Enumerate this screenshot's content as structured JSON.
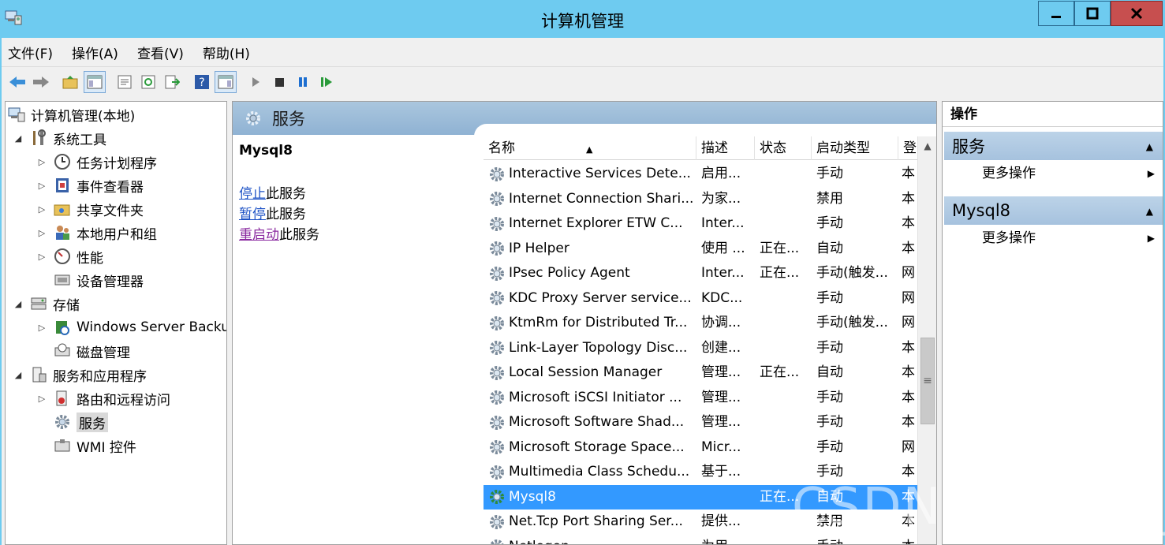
{
  "window": {
    "title": "计算机管理"
  },
  "menu": [
    "文件(F)",
    "操作(A)",
    "查看(V)",
    "帮助(H)"
  ],
  "tree": [
    {
      "label": "计算机管理(本地)",
      "level": 0,
      "arrow": "",
      "icon": "computer-management-icon"
    },
    {
      "label": "系统工具",
      "level": 1,
      "arrow": "◢",
      "icon": "system-tools-icon"
    },
    {
      "label": "任务计划程序",
      "level": 2,
      "arrow": "▷",
      "icon": "clock-icon"
    },
    {
      "label": "事件查看器",
      "level": 2,
      "arrow": "▷",
      "icon": "event-viewer-icon"
    },
    {
      "label": "共享文件夹",
      "level": 2,
      "arrow": "▷",
      "icon": "shared-folder-icon"
    },
    {
      "label": "本地用户和组",
      "level": 2,
      "arrow": "▷",
      "icon": "users-icon"
    },
    {
      "label": "性能",
      "level": 2,
      "arrow": "▷",
      "icon": "performance-icon"
    },
    {
      "label": "设备管理器",
      "level": 2,
      "arrow": "",
      "icon": "device-manager-icon"
    },
    {
      "label": "存储",
      "level": 1,
      "arrow": "◢",
      "icon": "storage-icon"
    },
    {
      "label": "Windows Server Backup",
      "level": 2,
      "arrow": "▷",
      "icon": "backup-icon"
    },
    {
      "label": "磁盘管理",
      "level": 2,
      "arrow": "",
      "icon": "disk-icon"
    },
    {
      "label": "服务和应用程序",
      "level": 1,
      "arrow": "◢",
      "icon": "services-apps-icon"
    },
    {
      "label": "路由和远程访问",
      "level": 2,
      "arrow": "▷",
      "icon": "routing-icon"
    },
    {
      "label": "服务",
      "level": 2,
      "arrow": "",
      "icon": "gear-icon",
      "selected": true
    },
    {
      "label": "WMI 控件",
      "level": 2,
      "arrow": "",
      "icon": "wmi-icon"
    }
  ],
  "center": {
    "title": "服务",
    "selected_service": "Mysql8",
    "links": [
      {
        "link": "停止",
        "rest": "此服务"
      },
      {
        "link": "暂停",
        "rest": "此服务"
      },
      {
        "link": "重启动",
        "rest": "此服务",
        "visited": true
      }
    ]
  },
  "table": {
    "columns": [
      "名称",
      "描述",
      "状态",
      "启动类型",
      "登"
    ],
    "rows": [
      {
        "name": "Interactive Services Dete...",
        "desc": "启用...",
        "status": "",
        "start": "手动",
        "logon": "本"
      },
      {
        "name": "Internet Connection Shari...",
        "desc": "为家...",
        "status": "",
        "start": "禁用",
        "logon": "本"
      },
      {
        "name": "Internet Explorer ETW C...",
        "desc": "Inter...",
        "status": "",
        "start": "手动",
        "logon": "本"
      },
      {
        "name": "IP Helper",
        "desc": "使用 ...",
        "status": "正在...",
        "start": "自动",
        "logon": "本"
      },
      {
        "name": "IPsec Policy Agent",
        "desc": "Inter...",
        "status": "正在...",
        "start": "手动(触发...",
        "logon": "网"
      },
      {
        "name": "KDC Proxy Server service...",
        "desc": "KDC...",
        "status": "",
        "start": "手动",
        "logon": "网"
      },
      {
        "name": "KtmRm for Distributed Tr...",
        "desc": "协调...",
        "status": "",
        "start": "手动(触发...",
        "logon": "网"
      },
      {
        "name": "Link-Layer Topology Disc...",
        "desc": "创建...",
        "status": "",
        "start": "手动",
        "logon": "本"
      },
      {
        "name": "Local Session Manager",
        "desc": "管理...",
        "status": "正在...",
        "start": "自动",
        "logon": "本"
      },
      {
        "name": "Microsoft iSCSI Initiator ...",
        "desc": "管理...",
        "status": "",
        "start": "手动",
        "logon": "本"
      },
      {
        "name": "Microsoft Software Shad...",
        "desc": "管理...",
        "status": "",
        "start": "手动",
        "logon": "本"
      },
      {
        "name": "Microsoft Storage Space...",
        "desc": "Micr...",
        "status": "",
        "start": "手动",
        "logon": "网"
      },
      {
        "name": "Multimedia Class Schedu...",
        "desc": "基于...",
        "status": "",
        "start": "手动",
        "logon": "本"
      },
      {
        "name": "Mysql8",
        "desc": "",
        "status": "正在...",
        "start": "自动",
        "logon": "本",
        "selected": true
      },
      {
        "name": "Net.Tcp Port Sharing Ser...",
        "desc": "提供...",
        "status": "",
        "start": "禁用",
        "logon": "本"
      },
      {
        "name": "Netlogon",
        "desc": "为用...",
        "status": "",
        "start": "手动",
        "logon": "本"
      }
    ]
  },
  "actions": {
    "title": "操作",
    "sections": [
      {
        "label": "服务",
        "item": "更多操作"
      },
      {
        "label": "Mysql8",
        "item": "更多操作"
      }
    ]
  },
  "watermark": "CSDN @mn_c_a"
}
